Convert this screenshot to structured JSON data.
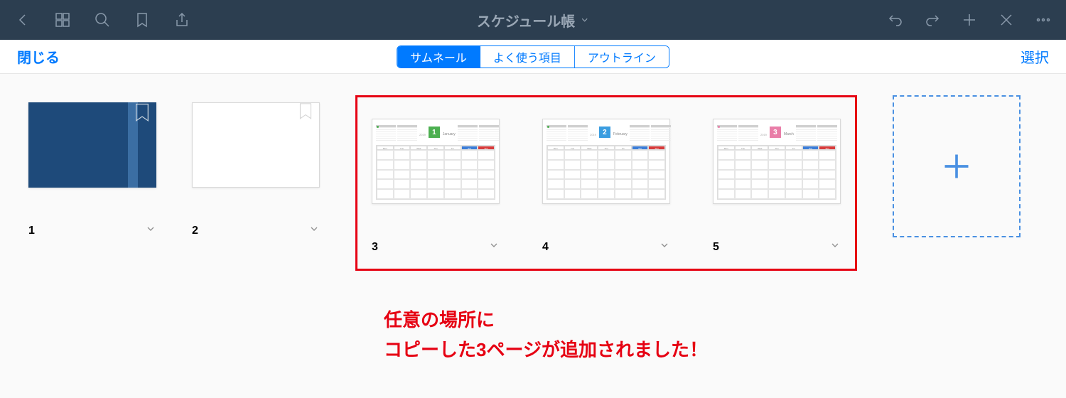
{
  "toolbar": {
    "title": "スケジュール帳"
  },
  "secondary": {
    "close": "閉じる",
    "select": "選択",
    "segments": {
      "thumbnail": "サムネール",
      "favorites": "よく使う項目",
      "outline": "アウトライン"
    }
  },
  "pages": {
    "p1": "1",
    "p2": "2",
    "p3": "3",
    "p4": "4",
    "p5": "5"
  },
  "calendars": {
    "year": "2019",
    "m1": {
      "num": "1",
      "name": "January",
      "color": "#4caf50"
    },
    "m2": {
      "num": "2",
      "name": "February",
      "color": "#3b9de0"
    },
    "m3": {
      "num": "3",
      "name": "March",
      "color": "#e97ea8"
    },
    "days": {
      "mon": "Mon",
      "tue": "Tue",
      "wed": "Wed",
      "thu": "Thu",
      "fri": "Fri",
      "sat": "Sat",
      "sun": "Sun"
    }
  },
  "annotation": {
    "line1": "任意の場所に",
    "line2": "コピーした3ページが追加されました！"
  }
}
